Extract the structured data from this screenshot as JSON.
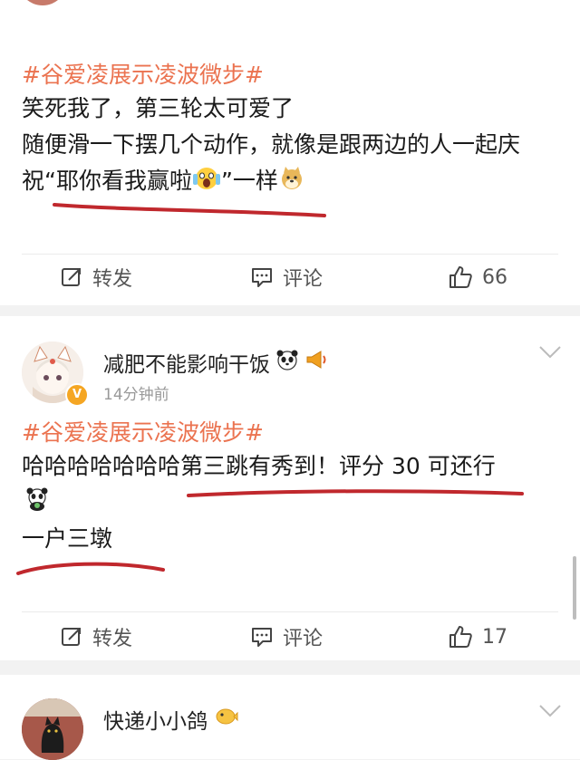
{
  "post1": {
    "hashtag": "#谷爱凌展示凌波微步#",
    "line1": "笑死我了，第三轮太可爱了",
    "line2": "随便滑一下摆几个动作，就像是跟两边的人一起庆",
    "line3_a": "祝“耶你看我赢啦",
    "line3_b": "”一样",
    "repost_label": "转发",
    "comment_label": "评论",
    "like_count": "66"
  },
  "post2": {
    "username": "减肥不能影响干饭",
    "time": "14分钟前",
    "hashtag": "#谷爱凌展示凌波微步#",
    "line1": "哈哈哈哈哈哈哈第三跳有秀到！评分 30 可还行",
    "line2": "一户三墩",
    "repost_label": "转发",
    "comment_label": "评论",
    "like_count": "17"
  },
  "post3": {
    "username": "快递小小鸽"
  },
  "colors": {
    "hashtag": "#eb7350",
    "underline": "#c0282d",
    "verified_badge": "#f5a623"
  }
}
